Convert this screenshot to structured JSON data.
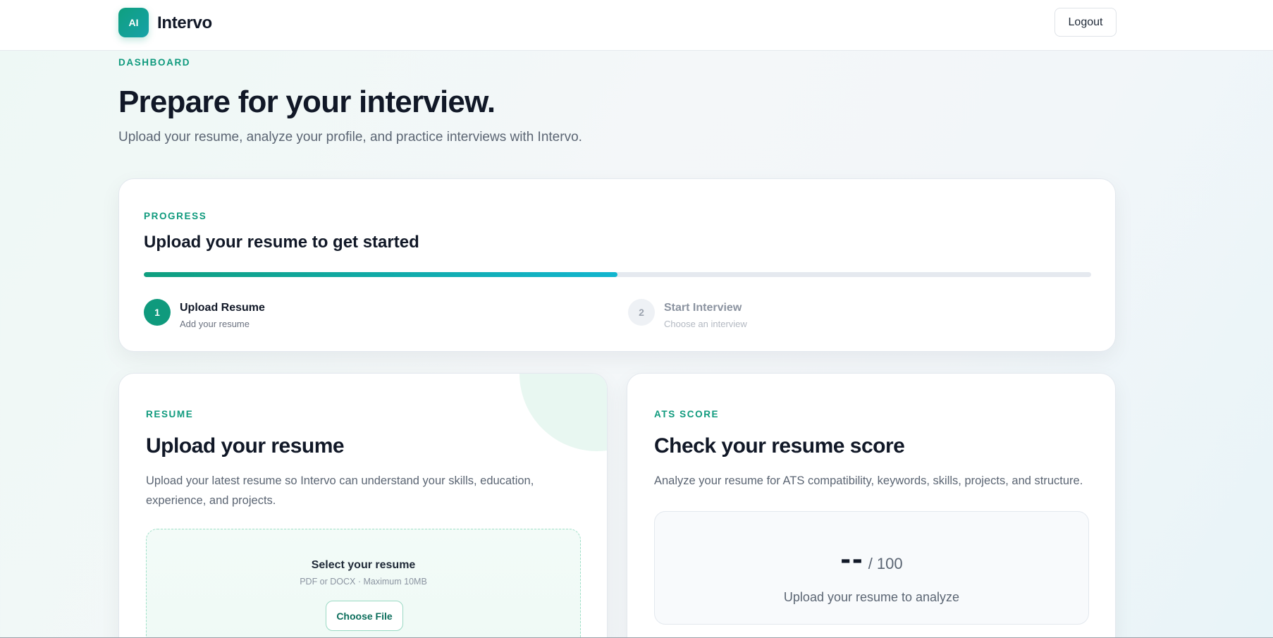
{
  "header": {
    "logo_text": "AI",
    "brand_name": "Intervo",
    "logout_label": "Logout"
  },
  "hero": {
    "eyebrow": "DASHBOARD",
    "title": "Prepare for your interview.",
    "subtitle": "Upload your resume, analyze your profile, and practice interviews with Intervo."
  },
  "progress": {
    "eyebrow": "PROGRESS",
    "title": "Upload your resume to get started",
    "fraction": 0.5,
    "steps": [
      {
        "number": "1",
        "title": "Upload Resume",
        "description": "Add your resume",
        "active": true
      },
      {
        "number": "2",
        "title": "Start Interview",
        "description": "Choose an interview",
        "active": false
      }
    ]
  },
  "resume": {
    "eyebrow": "RESUME",
    "title": "Upload your resume",
    "description": "Upload your latest resume so Intervo can understand your skills, education, experience, and projects.",
    "dropzone_title": "Select your resume",
    "dropzone_hint": "PDF or DOCX · Maximum 10MB",
    "choose_label": "Choose File"
  },
  "ats": {
    "eyebrow": "ATS SCORE",
    "title": "Check your resume score",
    "description": "Analyze your resume for ATS compatibility, keywords, skills, projects, and structure.",
    "score_value": "--",
    "score_max": "/ 100",
    "score_caption": "Upload your resume to analyze"
  },
  "colors": {
    "accent": "#0f9a7d",
    "accent_gradient_end": "#12b5cf"
  }
}
